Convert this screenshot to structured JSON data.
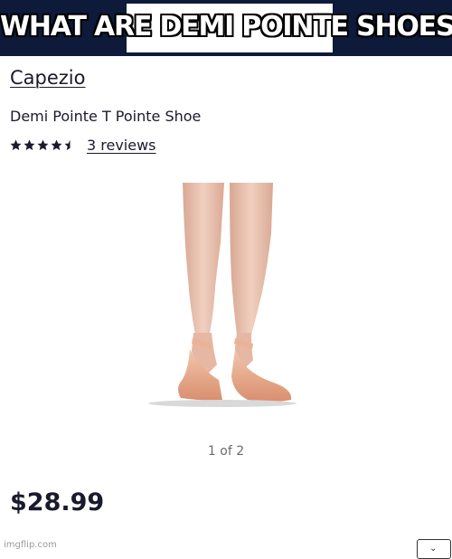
{
  "meme": {
    "caption": "WHAT ARE DEMI POINTE SHOES?"
  },
  "product": {
    "brand": "Capezio",
    "title": "Demi Pointe T Pointe Shoe",
    "rating": 4.5,
    "rating_max": 5,
    "reviews_label": "3 reviews",
    "image_icon": "ballet-legs-pointe-shoes-image"
  },
  "gallery": {
    "pager_label": "1 of 2"
  },
  "pricing": {
    "price": "$28.99"
  },
  "footer": {
    "watermark": "imgflip.com",
    "dropdown_icon": "chevron-down-icon"
  },
  "colors": {
    "header_bg": "#0d1a3a",
    "text": "#1a1a2e",
    "muted": "#6b6b6b",
    "skin": "#ecc4b0",
    "satin": "#e8a98a"
  }
}
